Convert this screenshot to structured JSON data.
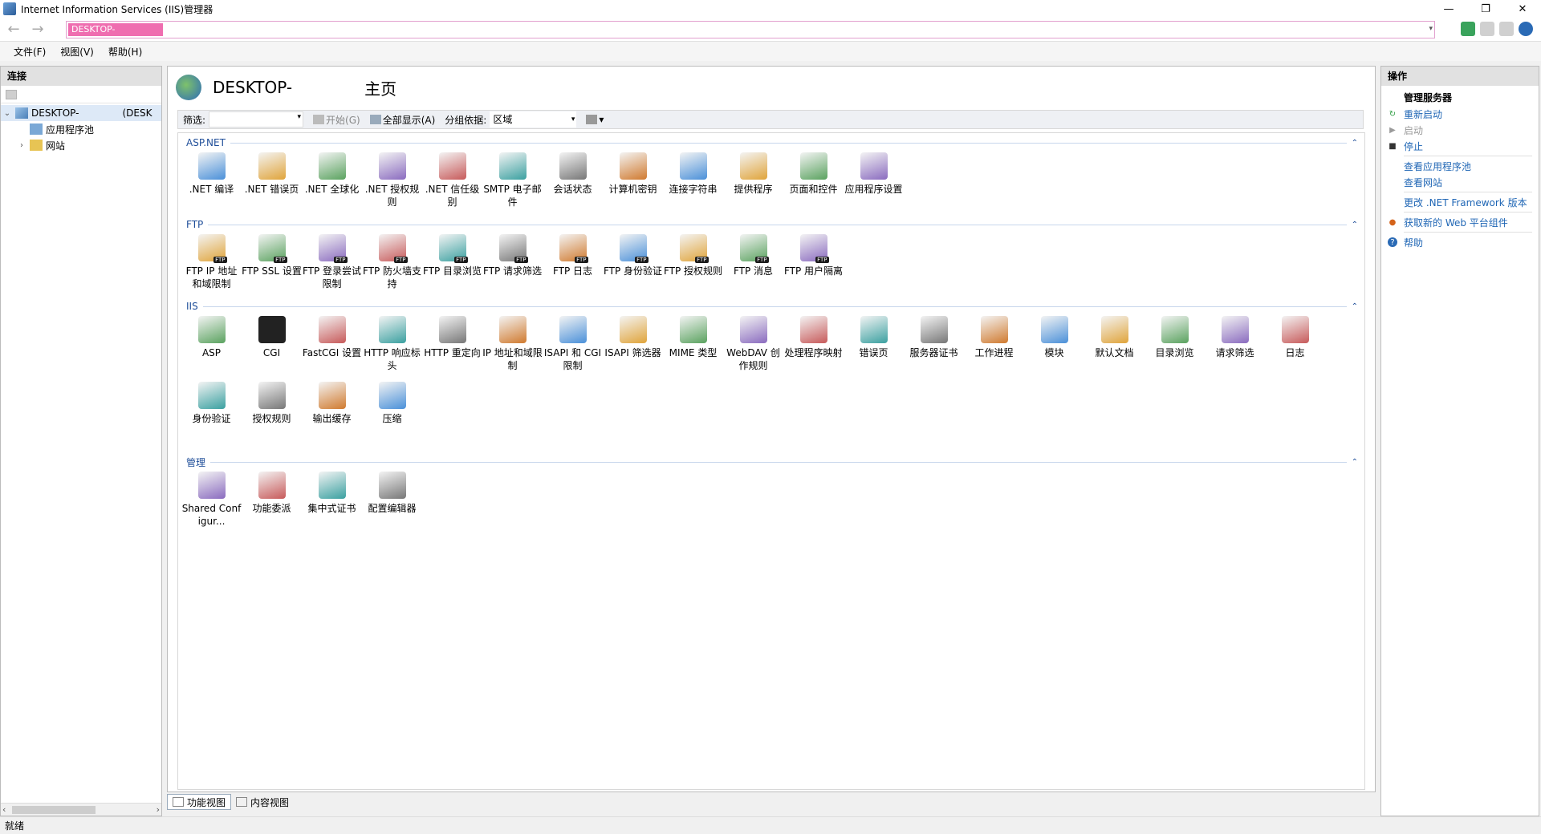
{
  "window": {
    "title": "Internet Information Services (IIS)管理器"
  },
  "address": {
    "segment": "DESKTOP-"
  },
  "menu": [
    "文件(F)",
    "视图(V)",
    "帮助(H)"
  ],
  "left": {
    "header": "连接",
    "tree": [
      {
        "label": "DESKTOP-",
        "extra": "(DESK",
        "expanded": true,
        "level": 0
      },
      {
        "label": "应用程序池",
        "level": 1
      },
      {
        "label": "网站",
        "level": 1,
        "collapsed": true
      }
    ]
  },
  "center": {
    "server": "DESKTOP-",
    "page": "主页",
    "filter": {
      "label": "筛选:",
      "start": "开始(G)",
      "showall": "全部显示(A)",
      "groupby_label": "分组依据:",
      "groupby_value": "区域"
    },
    "groups": [
      {
        "name": "ASP.NET",
        "items": [
          ".NET 编译",
          ".NET 错误页",
          ".NET 全球化",
          ".NET 授权规则",
          ".NET 信任级别",
          "SMTP 电子邮件",
          "会话状态",
          "计算机密钥",
          "连接字符串",
          "提供程序",
          "页面和控件",
          "应用程序设置"
        ]
      },
      {
        "name": "FTP",
        "items": [
          "FTP IP 地址和域限制",
          "FTP SSL 设置",
          "FTP 登录尝试限制",
          "FTP 防火墙支持",
          "FTP 目录浏览",
          "FTP 请求筛选",
          "FTP 日志",
          "FTP 身份验证",
          "FTP 授权规则",
          "FTP 消息",
          "FTP 用户隔离"
        ]
      },
      {
        "name": "IIS",
        "items": [
          "ASP",
          "CGI",
          "FastCGI 设置",
          "HTTP 响应标头",
          "HTTP 重定向",
          "IP 地址和域限制",
          "ISAPI 和 CGI 限制",
          "ISAPI 筛选器",
          "MIME 类型",
          "WebDAV 创作规则",
          "处理程序映射",
          "错误页",
          "服务器证书",
          "工作进程",
          "模块",
          "默认文档",
          "目录浏览",
          "请求筛选",
          "日志",
          "身份验证",
          "授权规则",
          "输出缓存",
          "压缩"
        ]
      },
      {
        "name": "管理",
        "items": [
          "Shared Configur...",
          "功能委派",
          "集中式证书",
          "配置编辑器"
        ]
      }
    ],
    "tabs": [
      "功能视图",
      "内容视图"
    ]
  },
  "right": {
    "header": "操作",
    "section": "管理服务器",
    "actions": [
      {
        "label": "重新启动",
        "icon": "restart-icon",
        "enabled": true
      },
      {
        "label": "启动",
        "icon": "start-icon",
        "enabled": false
      },
      {
        "label": "停止",
        "icon": "stop-icon",
        "enabled": true
      },
      {
        "sep": true
      },
      {
        "label": "查看应用程序池",
        "icon": "",
        "enabled": true
      },
      {
        "label": "查看网站",
        "icon": "",
        "enabled": true
      },
      {
        "sep": true
      },
      {
        "label": "更改 .NET Framework 版本",
        "icon": "",
        "enabled": true
      },
      {
        "sep": true
      },
      {
        "label": "获取新的 Web 平台组件",
        "icon": "web-platform-icon",
        "enabled": true
      },
      {
        "sep": true
      },
      {
        "label": "帮助",
        "icon": "help-icon",
        "enabled": true
      }
    ]
  },
  "status": "就绪"
}
